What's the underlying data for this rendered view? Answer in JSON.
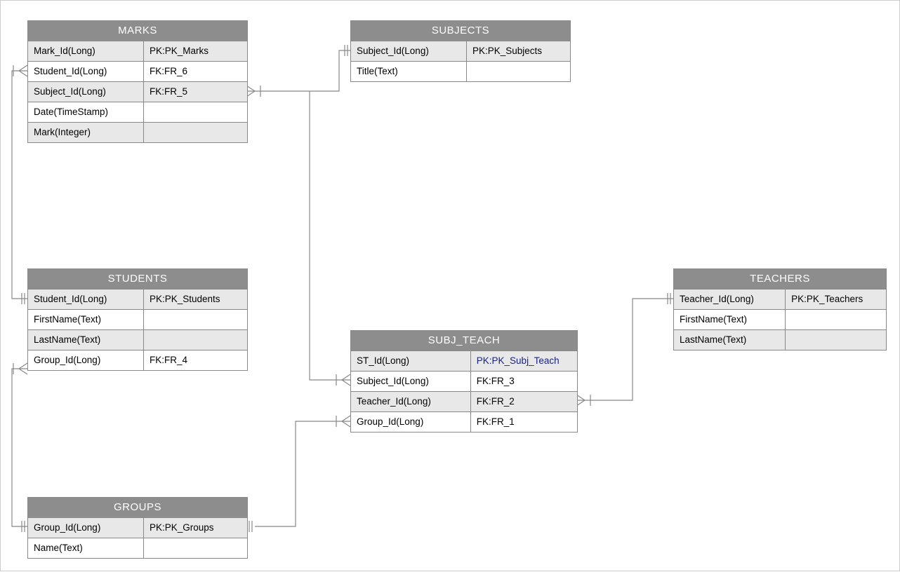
{
  "entities": {
    "marks": {
      "title": "MARKS",
      "rows": [
        {
          "name": "Mark_Id(Long)",
          "key": "PK:PK_Marks",
          "shaded": true
        },
        {
          "name": "Student_Id(Long)",
          "key": "FK:FR_6",
          "shaded": false
        },
        {
          "name": "Subject_Id(Long)",
          "key": "FK:FR_5",
          "shaded": true
        },
        {
          "name": "Date(TimeStamp)",
          "key": "",
          "shaded": false
        },
        {
          "name": "Mark(Integer)",
          "key": "",
          "shaded": true
        }
      ]
    },
    "subjects": {
      "title": "SUBJECTS",
      "rows": [
        {
          "name": "Subject_Id(Long)",
          "key": "PK:PK_Subjects",
          "shaded": true
        },
        {
          "name": "Title(Text)",
          "key": "",
          "shaded": false
        }
      ]
    },
    "students": {
      "title": "STUDENTS",
      "rows": [
        {
          "name": "Student_Id(Long)",
          "key": "PK:PK_Students",
          "shaded": true
        },
        {
          "name": "FirstName(Text)",
          "key": "",
          "shaded": false
        },
        {
          "name": "LastName(Text)",
          "key": "",
          "shaded": true
        },
        {
          "name": "Group_Id(Long)",
          "key": "FK:FR_4",
          "shaded": false
        }
      ]
    },
    "subj_teach": {
      "title": "SUBJ_TEACH",
      "rows": [
        {
          "name": "ST_Id(Long)",
          "key": "PK:PK_Subj_Teach",
          "shaded": true,
          "pk_blue": true
        },
        {
          "name": "Subject_Id(Long)",
          "key": "FK:FR_3",
          "shaded": false
        },
        {
          "name": "Teacher_Id(Long)",
          "key": "FK:FR_2",
          "shaded": true
        },
        {
          "name": "Group_Id(Long)",
          "key": "FK:FR_1",
          "shaded": false
        }
      ]
    },
    "teachers": {
      "title": "TEACHERS",
      "rows": [
        {
          "name": "Teacher_Id(Long)",
          "key": "PK:PK_Teachers",
          "shaded": true
        },
        {
          "name": "FirstName(Text)",
          "key": "",
          "shaded": false
        },
        {
          "name": "LastName(Text)",
          "key": "",
          "shaded": true
        }
      ]
    },
    "groups": {
      "title": "GROUPS",
      "rows": [
        {
          "name": "Group_Id(Long)",
          "key": "PK:PK_Groups",
          "shaded": true
        },
        {
          "name": "Name(Text)",
          "key": "",
          "shaded": false
        }
      ]
    }
  }
}
